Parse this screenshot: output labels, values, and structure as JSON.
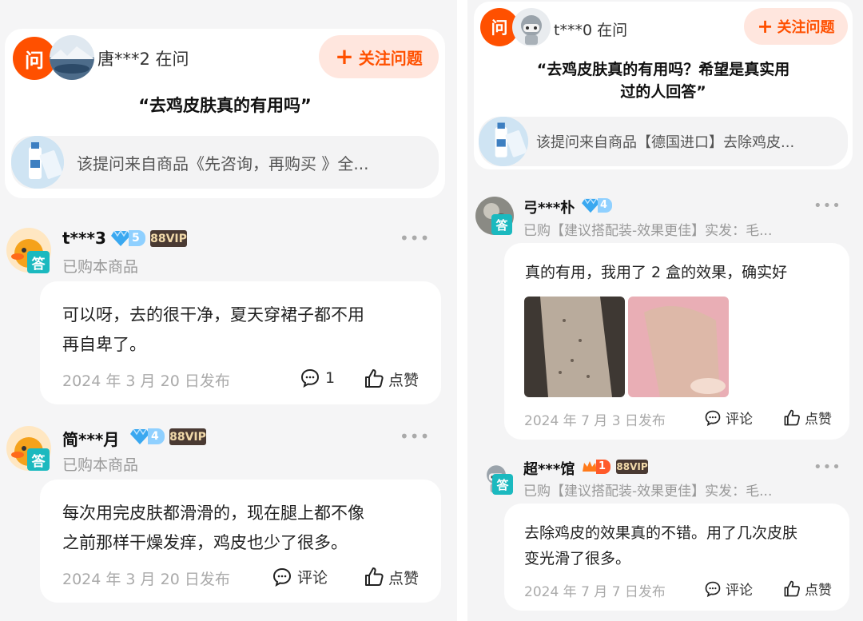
{
  "left": {
    "question": {
      "badge": "问",
      "asker": "唐***2 在问",
      "follow": "关注问题",
      "title": "“去鸡皮肤真的有用吗”",
      "product": "该提问来自商品《先咨询，再购买 》全..."
    },
    "answers": [
      {
        "name": "t***3",
        "level": "5",
        "vip": "88VIP",
        "badge": "答",
        "sub": "已购本商品",
        "text_line1": "可以呀，去的很干净，夏天穿裙子都不用",
        "text_line2": "再自卑了。",
        "date": "2024 年 3 月 20 日发布",
        "comment": "1",
        "like": "点赞"
      },
      {
        "name": "简***月",
        "level": "4",
        "vip": "88VIP",
        "badge": "答",
        "sub": "已购本商品",
        "text_line1": "每次用完皮肤都滑滑的，现在腿上都不像",
        "text_line2": "之前那样干燥发痒，鸡皮也少了很多。",
        "date": "2024 年 3 月 20 日发布",
        "comment": "评论",
        "like": "点赞"
      }
    ]
  },
  "right": {
    "question": {
      "badge": "问",
      "asker": "t***0 在问",
      "follow": "关注问题",
      "title_line1": "“去鸡皮肤真的有用吗？希望是真实用",
      "title_line2": "过的人回答”",
      "product": "该提问来自商品【德国进口】去除鸡皮..."
    },
    "answers": [
      {
        "name": "弓***朴",
        "level": "4",
        "badge": "答",
        "sub": "已购【建议搭配装-效果更佳】实发：毛...",
        "text": "真的有用，我用了 2 盒的效果，确实好",
        "date": "2024 年 7 月 3 日发布",
        "comment": "评论",
        "like": "点赞"
      },
      {
        "name": "超***馆",
        "level": "1",
        "vip": "88VIP",
        "badge": "答",
        "sub": "已购【建议搭配装-效果更佳】实发：毛...",
        "text_line1": "去除鸡皮的效果真的不错。用了几次皮肤",
        "text_line2": "变光滑了很多。",
        "date": "2024 年 7 月 7 日发布",
        "comment": "评论",
        "like": "点赞"
      }
    ]
  },
  "colors": {
    "accent": "#ff5000",
    "follow_bg": "#ffe6de",
    "answer_badge": "#1bb9bf",
    "vip_bg": "#4a3a33",
    "vip_text": "#f1d9a9",
    "diamond": "#3aa8f0",
    "crown": "#ff7a1a"
  },
  "icons": [
    "plus-icon",
    "comment-icon",
    "thumb-up-icon",
    "more-icon",
    "diamond-level-icon",
    "crown-level-icon"
  ]
}
